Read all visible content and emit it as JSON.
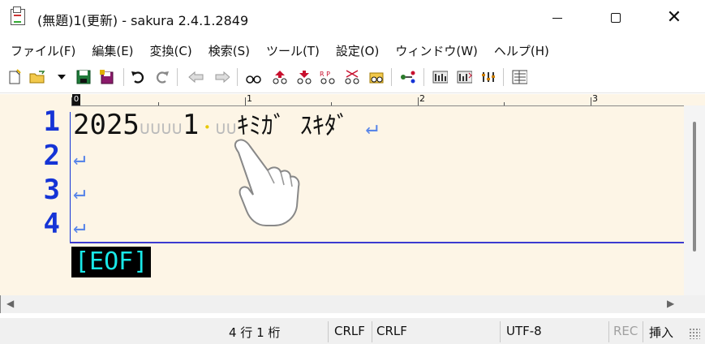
{
  "window": {
    "title": "(無題)1(更新) - sakura 2.4.1.2849",
    "minimize_icon": "minimize-icon",
    "maximize_icon": "maximize-icon",
    "close_icon": "close-icon"
  },
  "menu": {
    "items": [
      {
        "label": "ファイル(F)"
      },
      {
        "label": "編集(E)"
      },
      {
        "label": "変換(C)"
      },
      {
        "label": "検索(S)"
      },
      {
        "label": "ツール(T)"
      },
      {
        "label": "設定(O)"
      },
      {
        "label": "ウィンドウ(W)"
      },
      {
        "label": "ヘルプ(H)"
      }
    ]
  },
  "toolbar": {
    "buttons": [
      "new-file-icon",
      "open-file-icon",
      "dropdown-arrow-icon",
      "save-icon",
      "save-all-icon",
      "undo-icon",
      "redo-icon",
      "move-back-icon",
      "move-forward-icon",
      "search-icon",
      "search-prev-icon",
      "search-next-icon",
      "replace-icon",
      "search-mark-icon",
      "grep-icon",
      "jump-icon",
      "outline-icon",
      "compare-icon",
      "filter-icon",
      "settings-icon"
    ]
  },
  "editor": {
    "ruler": {
      "marks": [
        "0",
        "1",
        "2",
        "3"
      ]
    },
    "line_numbers": [
      "1",
      "2",
      "3",
      "4"
    ],
    "lines": [
      {
        "prefix": "2025",
        "spaces1": "∪∪∪∪",
        "mid": "1",
        "dot": "・",
        "spaces2": "∪∪",
        "text": "ｷﾐｶﾞ ｽｷﾀﾞ",
        "newline": "↵"
      },
      {
        "newline": "↵"
      },
      {
        "newline": "↵"
      },
      {
        "newline": "↵"
      }
    ],
    "eof": "[EOF]"
  },
  "status": {
    "position": "4 行   1 桁",
    "line_ending": "CRLF",
    "line_ending2": "CRLF",
    "encoding": "UTF-8",
    "rec": "REC",
    "mode": "挿入"
  }
}
